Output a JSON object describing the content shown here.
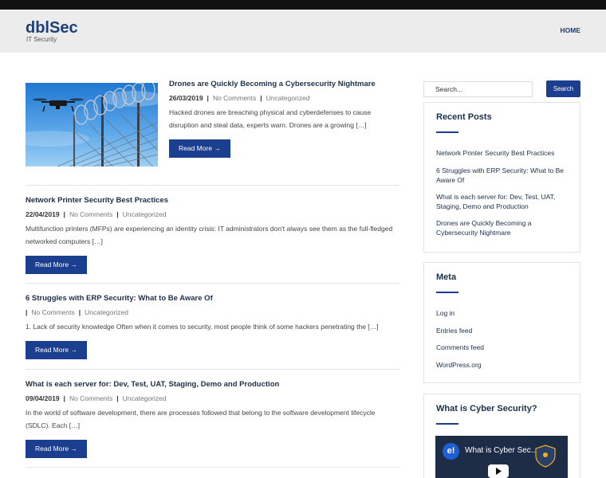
{
  "header": {
    "site_title": "dblSec",
    "tagline": "IT Security",
    "nav_home": "HOME"
  },
  "posts": [
    {
      "title": "Drones are Quickly Becoming a Cybersecurity Nightmare",
      "date": "26/03/2019",
      "comments": "No Comments",
      "category": "Uncategorized",
      "excerpt": "Hacked drones are breaching physical and cyberdefenses to cause disruption and steal data, experts warn. Drones are a growing […]",
      "read_more": "Read More →"
    },
    {
      "title": "Network Printer Security Best Practices",
      "date": "22/04/2019",
      "comments": "No Comments",
      "category": "Uncategorized",
      "excerpt": "Multifunction printers (MFPs) are experiencing an identity crisis:  IT administrators don't always see them as the full-fledged networked computers […]",
      "read_more": "Read More →"
    },
    {
      "title": "6 Struggles with ERP Security: What to Be Aware Of",
      "date": "",
      "comments": "No Comments",
      "category": "Uncategorized",
      "excerpt": "1. Lack of security knowledge Often when it comes to security, most people think of some hackers penetrating the […]",
      "read_more": "Read More →"
    },
    {
      "title": "What is each server for: Dev, Test, UAT, Staging, Demo and Production",
      "date": "09/04/2019",
      "comments": "No Comments",
      "category": "Uncategorized",
      "excerpt": "In the world of software development, there are processes followed that belong to the software development lifecycle (SDLC). Each […]",
      "read_more": "Read More →"
    }
  ],
  "sidebar": {
    "search_placeholder": "Search...",
    "search_button": "Search",
    "recent_posts_title": "Recent Posts",
    "recent_posts": [
      "Network Printer Security Best Practices",
      "6 Struggles with ERP Security: What to Be Aware Of",
      "What is each server for: Dev, Test, UAT, Staging, Demo and Production",
      "Drones are Quickly Becoming a Cybersecurity Nightmare"
    ],
    "meta_title": "Meta",
    "meta_links": [
      "Log in",
      "Entries feed",
      "Comments feed",
      "WordPress.org"
    ],
    "video_widget_title": "What is Cyber Security?",
    "video_logo": "e!",
    "video_title": "What is Cyber Sec..."
  },
  "colors": {
    "accent": "#1c3e8f",
    "brand": "#1c3e7a",
    "topbar": "#111111",
    "header_bg": "#ececec"
  }
}
